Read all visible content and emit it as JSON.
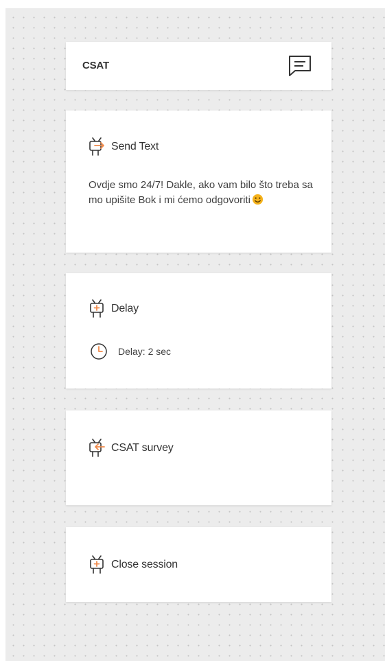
{
  "header": {
    "title": "CSAT",
    "icon": "chat-message-icon"
  },
  "nodes": [
    {
      "title": "Send Text",
      "icon": "robot-send-icon",
      "text": "Ovdje smo 24/7! Dakle, ako vam bilo što treba samo upišite Bok i mi ćemo odgovoriti",
      "emoji": "smiling-face-emoji"
    },
    {
      "title": "Delay",
      "icon": "robot-delay-icon",
      "delay_text": "Delay: 2 sec",
      "delay_icon": "clock-icon"
    },
    {
      "title": "CSAT survey",
      "icon": "robot-survey-icon"
    },
    {
      "title": "Close session",
      "icon": "robot-close-icon"
    }
  ],
  "colors": {
    "canvas": "#ececec",
    "card": "#ffffff",
    "accent": "#f08a4b",
    "icon_dark": "#333333",
    "emoji": "#f5b21b"
  }
}
